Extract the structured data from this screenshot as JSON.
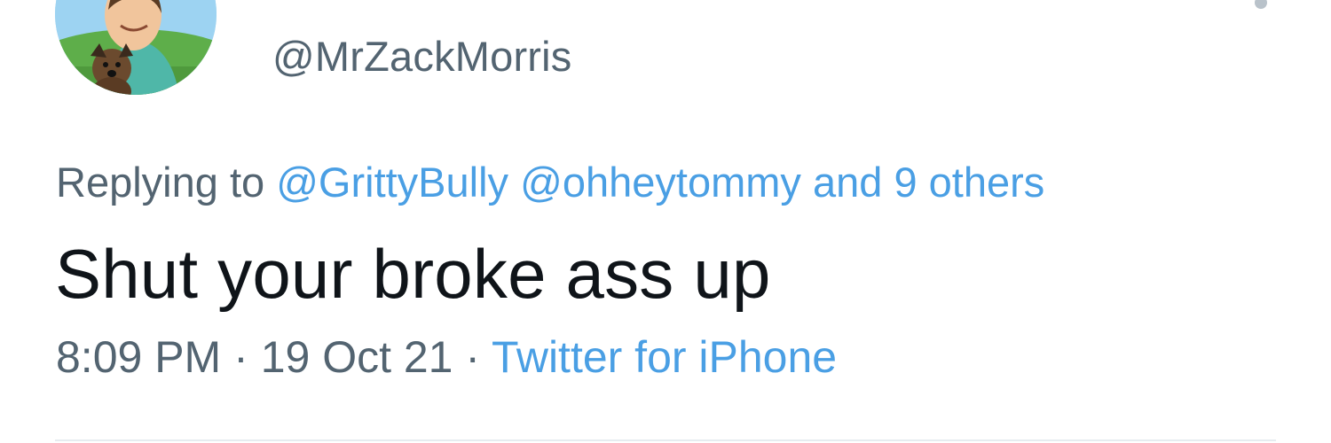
{
  "tweet": {
    "handle": "@MrZackMorris",
    "reply_prefix": "Replying to",
    "reply_mentions": [
      "@GrittyBully",
      "@ohheytommy"
    ],
    "reply_others": "and 9 others",
    "text": "Shut your broke ass up",
    "time": "8:09 PM",
    "date": "19 Oct 21",
    "source": "Twitter for iPhone",
    "separator": "·"
  },
  "colors": {
    "link": "#4a9fe4",
    "secondary_text": "#536471",
    "primary_text": "#0f1419"
  },
  "icons": {
    "more": "more-options-icon"
  }
}
